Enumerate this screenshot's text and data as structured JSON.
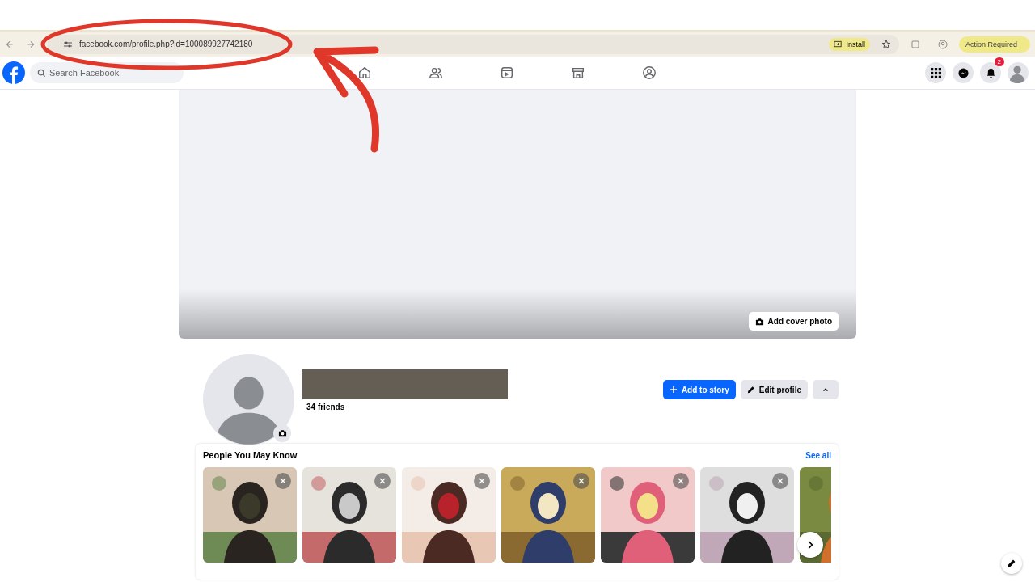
{
  "browser": {
    "url": "facebook.com/profile.php?id=100089927742180",
    "install": "Install",
    "action": "Action Required"
  },
  "topbar": {
    "search": {
      "placeholder": "Search Facebook"
    },
    "notifications": "2"
  },
  "cover": {
    "button": "Add cover photo"
  },
  "profile": {
    "friends": "34 friends",
    "buttons": [
      {
        "kind": "primary",
        "label": "Add to story"
      },
      {
        "kind": "secondary",
        "label": "Edit profile"
      },
      {
        "kind": "more"
      }
    ]
  },
  "pymk": {
    "title": "People You May Know",
    "see_all": "See all",
    "cards": [
      {
        "kind": "picture",
        "dismiss": true
      },
      {
        "kind": "picture",
        "dismiss": true
      },
      {
        "kind": "picture",
        "dismiss": true
      },
      {
        "kind": "picture",
        "dismiss": true
      },
      {
        "kind": "picture",
        "dismiss": true
      },
      {
        "kind": "picture",
        "dismiss": true
      },
      {
        "kind": "picture",
        "dismiss": false
      }
    ]
  }
}
